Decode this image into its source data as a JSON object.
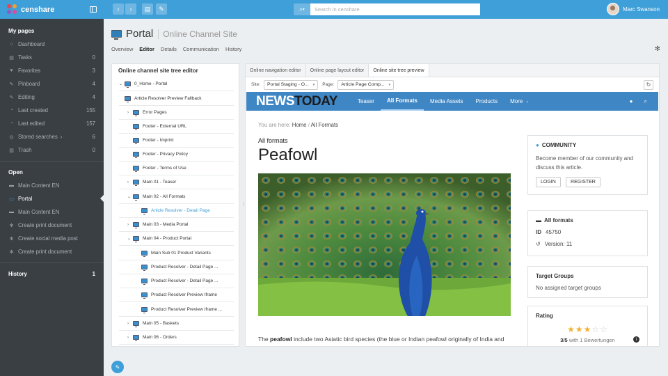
{
  "app": {
    "logo_text": "censhare"
  },
  "sidebar": {
    "my_pages": "My pages",
    "items": [
      {
        "label": "Dashboard",
        "count": "",
        "icon": "home-icon"
      },
      {
        "label": "Tasks",
        "count": "0",
        "icon": "task-icon"
      },
      {
        "label": "Favorites",
        "count": "3",
        "icon": "heart-icon"
      },
      {
        "label": "Pinboard",
        "count": "4",
        "icon": "pin-icon"
      },
      {
        "label": "Editing",
        "count": "4",
        "icon": "edit-icon"
      },
      {
        "label": "Last created",
        "count": "155",
        "icon": "clock-icon"
      },
      {
        "label": "Last edited",
        "count": "157",
        "icon": "clock-icon"
      },
      {
        "label": "Stored searches",
        "count": "6",
        "icon": "search-icon"
      },
      {
        "label": "Trash",
        "count": "0",
        "icon": "trash-icon"
      }
    ],
    "open_title": "Open",
    "open_items": [
      {
        "label": "Main Content EN",
        "icon": "document-icon"
      },
      {
        "label": "Portal",
        "icon": "monitor-icon"
      },
      {
        "label": "Main Content EN",
        "icon": "document-icon"
      },
      {
        "label": "Create print document",
        "icon": "gear-icon"
      },
      {
        "label": "Create social media post",
        "icon": "gear-icon"
      },
      {
        "label": "Create print document",
        "icon": "gear-icon"
      }
    ],
    "history_title": "History",
    "history_count": "1"
  },
  "topbar": {
    "search_placeholder": "Search in censhare",
    "user_name": "Marc Swanson"
  },
  "page": {
    "title": "Portal",
    "subtitle": "Online Channel Site",
    "tabs": [
      "Overview",
      "Editor",
      "Details",
      "Communication",
      "History"
    ]
  },
  "tree": {
    "title": "Online channel site tree editor",
    "rows": [
      {
        "label": "0_Home - Portal"
      },
      {
        "label": "Article Resolver Preview Fallback"
      },
      {
        "label": "Error Pages"
      },
      {
        "label": "Footer - External URL"
      },
      {
        "label": "Footer - Imprint"
      },
      {
        "label": "Footer - Privacy Policy"
      },
      {
        "label": "Footer - Terms of Use"
      },
      {
        "label": "Main 01 - Teaser"
      },
      {
        "label": "Main 02 - All Formats"
      },
      {
        "label": "Article Resolver - Detail Page"
      },
      {
        "label": "Main 03 - Media Portal"
      },
      {
        "label": "Main 04 - Product Portal"
      },
      {
        "label": "Main Sub 01 Product Variants"
      },
      {
        "label": "Product Resolver - Detail Page ..."
      },
      {
        "label": "Product Resolver - Detail Page ..."
      },
      {
        "label": "Product Resolver Preview Iframe"
      },
      {
        "label": "Product Resolver Preview Iframe ..."
      },
      {
        "label": "Main 05 - Baskets"
      },
      {
        "label": "Main 06 - Orders"
      }
    ]
  },
  "preview": {
    "tabs": [
      "Online navigation editor",
      "Online page layout editor",
      "Online site tree preview"
    ],
    "site_label": "Site:",
    "site_value": "Portal Staging - O...",
    "page_label": "Page:",
    "page_value": "Article Page Comp...",
    "brand_1": "NEWS",
    "brand_2": "TODAY",
    "nav": [
      "Teaser",
      "All Formats",
      "Media Assets",
      "Products",
      "More"
    ],
    "breadcrumb_prefix": "You are here:",
    "breadcrumb_home": "Home",
    "breadcrumb_current": "All Formats",
    "category": "All formats",
    "headline": "Peafowl",
    "para_bold": "peafowl",
    "para_1": "The",
    "para_2": "include two Asiatic bird species (the blue or Indian peafowl originally of India and Sri Lanka and the green peafowl of Myanmar, Indochina, and Java) and",
    "community_title": "COMMUNITY",
    "community_text": "Become member of our community and discuss this article.",
    "login": "LOGIN",
    "register": "REGISTER",
    "info_title": "All formats",
    "id_label": "ID",
    "id_value": "45750",
    "version": "Version: 11",
    "tg_title": "Target Groups",
    "tg_text": "No assigned target groups",
    "rating_title": "Rating",
    "rating_value": 3,
    "rating_max": 5,
    "rating_score": "3/5",
    "rating_text": "with 1 Bewertungen"
  }
}
